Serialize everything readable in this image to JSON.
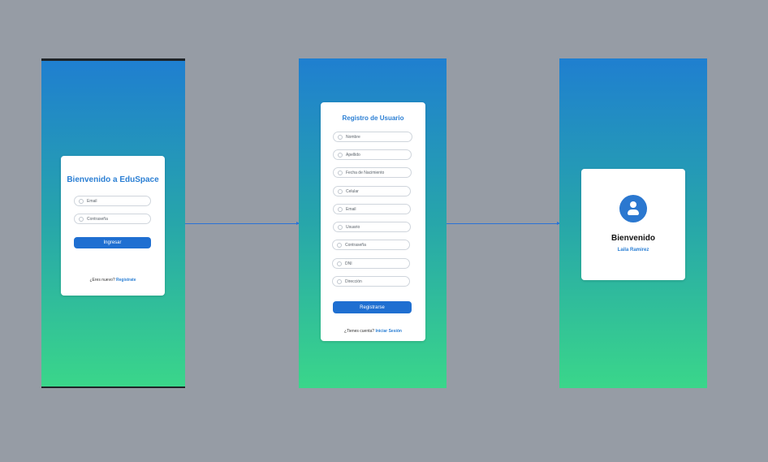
{
  "login": {
    "title": "Bienvenido a EduSpace",
    "email_placeholder": "Email",
    "password_placeholder": "Contraseña",
    "submit_label": "Ingresar",
    "footer_text": "¿Eres nuevo?",
    "footer_link": "Registrate"
  },
  "register": {
    "title": "Registro de Usuario",
    "fields": [
      {
        "label": "Nombre",
        "icon": "user-icon"
      },
      {
        "label": "Apellido",
        "icon": "user-icon"
      },
      {
        "label": "Fecha de Nacimiento",
        "icon": "calendar-icon"
      },
      {
        "label": "Celular",
        "icon": "phone-icon"
      },
      {
        "label": "Email",
        "icon": "mail-icon"
      },
      {
        "label": "Usuario",
        "icon": "user-icon"
      },
      {
        "label": "Contraseña",
        "icon": "lock-icon"
      },
      {
        "label": "DNI",
        "icon": "id-icon"
      },
      {
        "label": "Dirección",
        "icon": "location-icon"
      }
    ],
    "submit_label": "Registrarse",
    "footer_text": "¿Tienes cuenta?",
    "footer_link": "Iniciar Sesión"
  },
  "welcome": {
    "title": "Bienvenido",
    "name": "Laila Ramirez"
  },
  "colors": {
    "canvas": "#969ca5",
    "accent": "#1f6fd1",
    "gradient_top": "#1f7fd0",
    "gradient_bottom": "#3ad68a"
  }
}
